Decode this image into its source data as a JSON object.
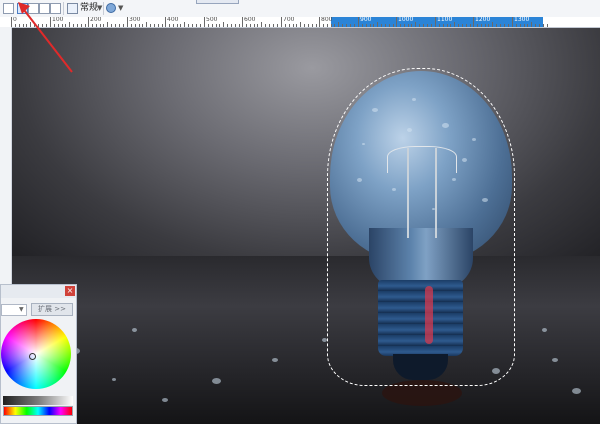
{
  "toolbar": {
    "selection_mode_label": "常规",
    "icons": [
      "new-selection-icon",
      "add-selection-icon",
      "subtract-selection-icon",
      "intersect-selection-icon",
      "copy-selection-icon",
      "mode-icon",
      "antialias-icon"
    ]
  },
  "ruler": {
    "labels": [
      "0",
      "100",
      "200",
      "300",
      "400",
      "500",
      "600",
      "700",
      "800",
      "900",
      "1000",
      "1100",
      "1200",
      "1300"
    ],
    "highlight_color": "#2b84d7"
  },
  "color_panel": {
    "close_symbol": "×",
    "expand_label": "扩展 >>"
  },
  "colors": {
    "annotation_arrow": "#e02a2a",
    "toolbar_bg": "#f3f5f8"
  }
}
